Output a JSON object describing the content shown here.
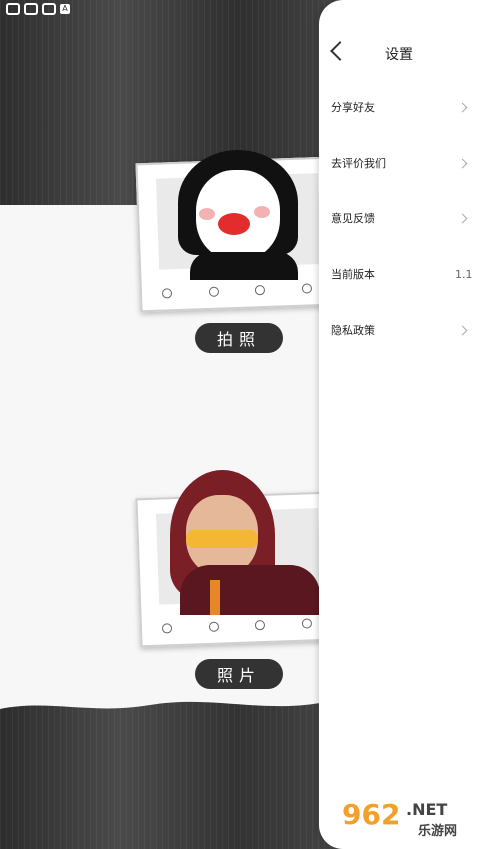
{
  "status": {
    "badge": "A"
  },
  "main": {
    "take_photo_label": "拍照",
    "photos_label": "照片"
  },
  "settings": {
    "title": "设置",
    "items": [
      {
        "label": "分享好友"
      },
      {
        "label": "去评价我们"
      },
      {
        "label": "意见反馈"
      },
      {
        "label": "当前版本",
        "value": "1.1"
      },
      {
        "label": "隐私政策"
      }
    ]
  },
  "watermark": {
    "number": "962",
    "suffix": ".NET",
    "cn": "乐游网"
  }
}
